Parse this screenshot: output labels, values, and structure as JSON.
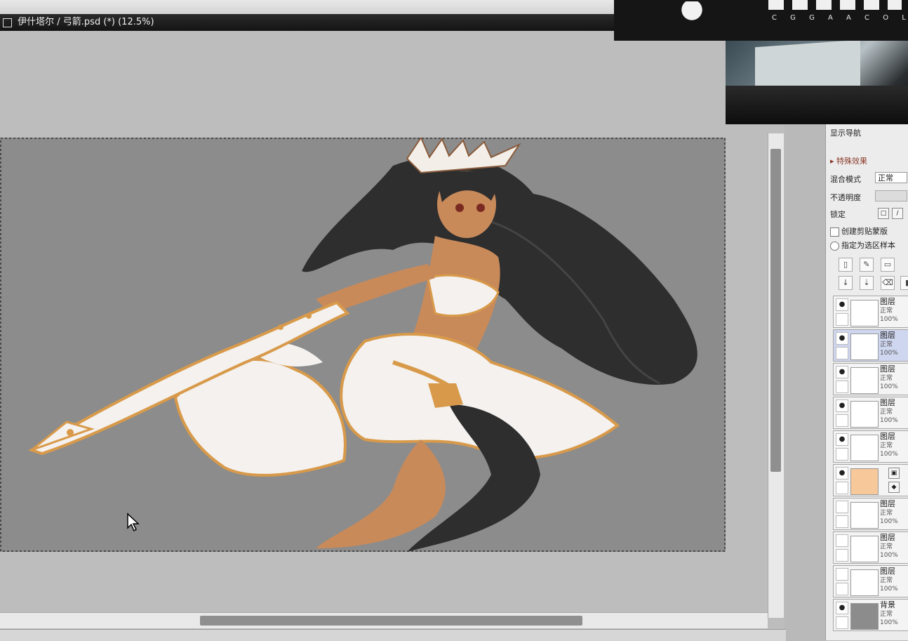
{
  "document": {
    "title": "伊什塔尔 / 弓箭.psd (*) (12.5%)"
  },
  "banner": {
    "subtitle": "C G G A A   C O L L E S"
  },
  "layer_panel": {
    "header": "显示导航",
    "section_title": "▸ 特殊效果",
    "blend_label": "混合模式",
    "blend_value": "正常",
    "opacity_label": "不透明度",
    "lock_label": "锁定",
    "clip_label": "创建剪贴蒙版",
    "ref_label": "指定为选区样本",
    "layers": [
      {
        "name": "图层",
        "mode": "正常",
        "opacity": "100%",
        "visible": true,
        "selected": false
      },
      {
        "name": "图层",
        "mode": "正常",
        "opacity": "100%",
        "visible": true,
        "selected": true
      },
      {
        "name": "图层",
        "mode": "正常",
        "opacity": "100%",
        "visible": true,
        "selected": false
      },
      {
        "name": "图层",
        "mode": "正常",
        "opacity": "100%",
        "visible": true,
        "selected": false
      },
      {
        "name": "图层",
        "mode": "正常",
        "opacity": "100%",
        "visible": true,
        "selected": false
      },
      {
        "name": "",
        "mode": "",
        "opacity": "",
        "visible": true,
        "selected": false
      },
      {
        "name": "图层",
        "mode": "正常",
        "opacity": "100%",
        "visible": false,
        "selected": false
      },
      {
        "name": "图层",
        "mode": "正常",
        "opacity": "100%",
        "visible": false,
        "selected": false
      },
      {
        "name": "图层",
        "mode": "正常",
        "opacity": "100%",
        "visible": false,
        "selected": false
      },
      {
        "name": "背景",
        "mode": "正常",
        "opacity": "100%",
        "visible": true,
        "selected": false
      }
    ]
  },
  "colors": {
    "canvas_bg": "#8c8c8c",
    "accent_gold": "#d89a4a",
    "hair": "#2e2e2e"
  }
}
